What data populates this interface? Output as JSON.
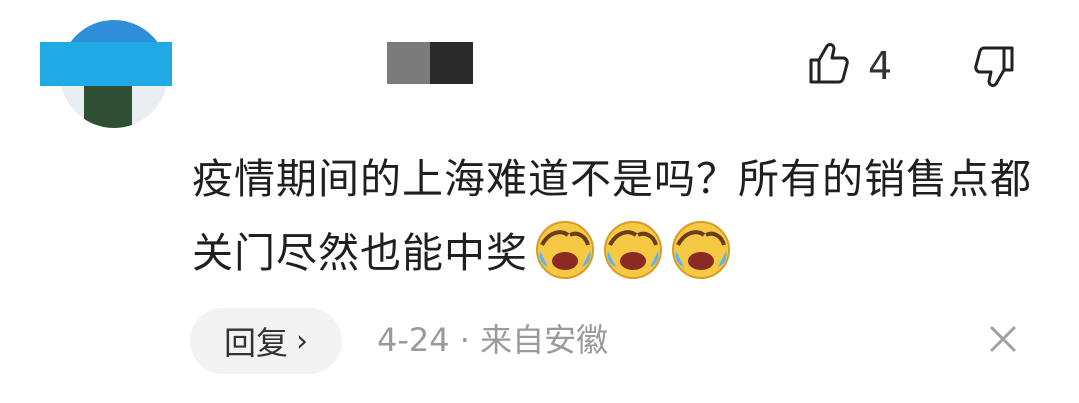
{
  "comment": {
    "text": "疫情期间的上海难道不是吗？所有的销售点都关门尽然也能中奖",
    "emojis": [
      "laughing-crying-emoji",
      "laughing-crying-emoji",
      "laughing-crying-emoji"
    ]
  },
  "likes": {
    "count": "4"
  },
  "actions": {
    "reply_label": "回复",
    "reply_chevron": "›"
  },
  "meta": {
    "date": "4-24",
    "separator": "·",
    "location": "来自安徽"
  },
  "icons": {
    "like": "thumbs-up-icon",
    "dislike": "thumbs-down-icon",
    "close": "close-icon"
  },
  "colors": {
    "name_mask": "#21a9e6",
    "text": "#1f1f1f",
    "meta": "#9a9a9a",
    "reply_bg": "#f3f3f3"
  }
}
